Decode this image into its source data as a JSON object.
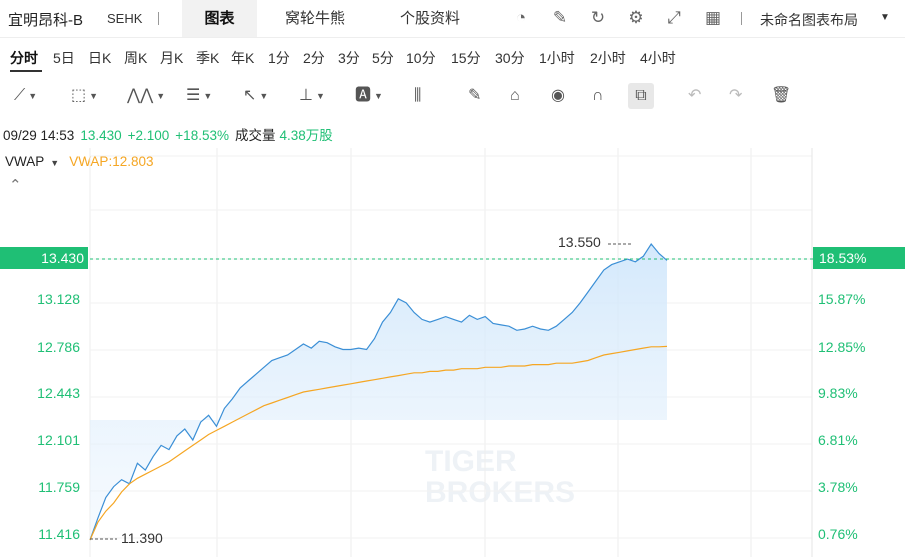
{
  "header": {
    "stock_name": "宜明昂科-B",
    "stock_code": "SEHK",
    "tabs": [
      {
        "label": "图表",
        "active": true
      },
      {
        "label": "窝轮牛熊",
        "active": false
      },
      {
        "label": "个股资料",
        "active": false
      }
    ],
    "icons": [
      "gauge-icon",
      "edit-icon",
      "refresh-icon",
      "settings-icon",
      "fullscreen-icon",
      "grid-layout-icon"
    ],
    "layout_name": "未命名图表布局"
  },
  "periods": [
    "分时",
    "5日",
    "日K",
    "周K",
    "月K",
    "季K",
    "年K",
    "1分",
    "2分",
    "3分",
    "5分",
    "10分",
    "15分",
    "30分",
    "1小时",
    "2小时",
    "4小时"
  ],
  "active_period": "分时",
  "tools": [
    "line-tool-icon",
    "rectangle-tool-icon",
    "pattern-tool-icon",
    "fib-tool-icon",
    "arrow-tool-icon",
    "measure-tool-icon",
    "text-tool-icon",
    "indicator-tool-icon",
    "pencil-icon",
    "lock-icon",
    "eye-icon",
    "magnet-icon",
    "link-icon",
    "undo-icon",
    "redo-icon",
    "trash-icon"
  ],
  "info": {
    "datetime": "09/29 14:53",
    "price": "13.430",
    "change": "+2.100",
    "change_pct": "+18.53%",
    "volume_label": "成交量",
    "volume": "4.38万股"
  },
  "indicator": {
    "name": "VWAP",
    "value_text": "VWAP:12.803"
  },
  "colors": {
    "up": "#1fbf75",
    "price_line": "#3b8fd6",
    "vwap_line": "#f5a623"
  },
  "chart_data": {
    "type": "line",
    "left_axis": [
      "13.128",
      "12.786",
      "12.443",
      "12.101",
      "11.759",
      "11.416"
    ],
    "right_axis": [
      "15.87%",
      "12.85%",
      "9.83%",
      "6.81%",
      "3.78%",
      "0.76%"
    ],
    "current_price": "13.430",
    "current_pct": "18.53%",
    "high_label": "13.550",
    "low_label": "11.390",
    "ylim": [
      11.33,
      13.9
    ],
    "watermark": [
      "TIGER",
      "BROKERS"
    ],
    "series": [
      {
        "values": [
          11.39,
          11.55,
          11.7,
          11.78,
          11.83,
          11.8,
          11.95,
          11.9,
          12.0,
          12.08,
          12.05,
          12.15,
          12.2,
          12.12,
          12.25,
          12.3,
          12.22,
          12.35,
          12.42,
          12.5,
          12.55,
          12.6,
          12.65,
          12.7,
          12.72,
          12.74,
          12.78,
          12.82,
          12.79,
          12.84,
          12.83,
          12.8,
          12.78,
          12.78,
          12.79,
          12.78,
          12.86,
          12.98,
          13.05,
          13.15,
          13.12,
          13.05,
          13.0,
          12.98,
          13.0,
          13.02,
          13.0,
          12.98,
          13.03,
          13.0,
          13.02,
          12.97,
          12.96,
          12.95,
          12.92,
          12.93,
          12.95,
          12.93,
          12.92,
          12.95,
          13.0,
          13.05,
          13.12,
          13.2,
          13.28,
          13.36,
          13.4,
          13.42,
          13.44,
          13.42,
          13.46,
          13.55,
          13.48,
          13.43
        ]
      },
      {
        "values": [
          11.39,
          11.52,
          11.6,
          11.66,
          11.74,
          11.8,
          11.84,
          11.87,
          11.9,
          11.93,
          11.96,
          12.0,
          12.04,
          12.08,
          12.12,
          12.16,
          12.19,
          12.22,
          12.25,
          12.28,
          12.31,
          12.34,
          12.37,
          12.39,
          12.41,
          12.43,
          12.45,
          12.47,
          12.48,
          12.49,
          12.5,
          12.51,
          12.52,
          12.53,
          12.54,
          12.55,
          12.56,
          12.57,
          12.58,
          12.59,
          12.6,
          12.61,
          12.61,
          12.62,
          12.62,
          12.63,
          12.63,
          12.64,
          12.64,
          12.64,
          12.65,
          12.65,
          12.65,
          12.66,
          12.66,
          12.66,
          12.67,
          12.67,
          12.67,
          12.68,
          12.68,
          12.68,
          12.69,
          12.7,
          12.72,
          12.74,
          12.75,
          12.76,
          12.77,
          12.78,
          12.79,
          12.8,
          12.8,
          12.803
        ]
      }
    ]
  }
}
